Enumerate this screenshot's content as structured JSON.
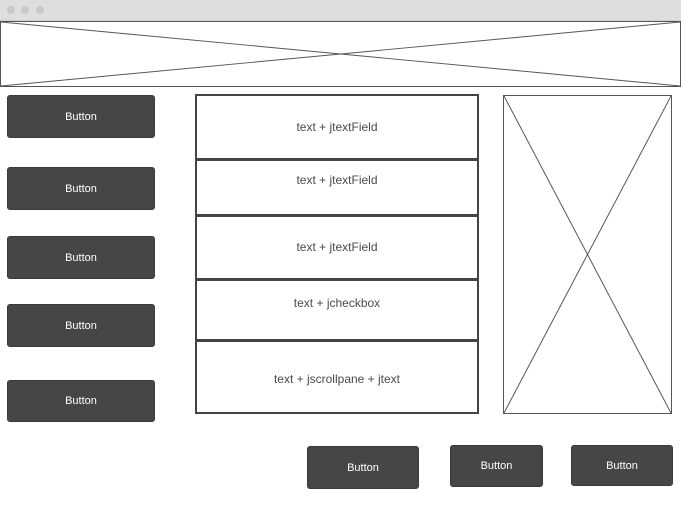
{
  "window": {
    "controls": [
      "close-dot",
      "minimize-dot",
      "maximize-dot"
    ]
  },
  "left_buttons": [
    {
      "label": "Button"
    },
    {
      "label": "Button"
    },
    {
      "label": "Button"
    },
    {
      "label": "Button"
    },
    {
      "label": "Button"
    }
  ],
  "form_rows": [
    {
      "label": "text + jtextField"
    },
    {
      "label": "text + jtextField"
    },
    {
      "label": "text + jtextField"
    },
    {
      "label": "text + jcheckbox"
    },
    {
      "label": "text + jscrollpane + jtext"
    }
  ],
  "bottom_buttons": [
    {
      "label": "Button"
    },
    {
      "label": "Button"
    },
    {
      "label": "Button"
    }
  ],
  "colors": {
    "button_bg": "#464646",
    "button_text": "#ffffff",
    "titlebar": "#dedede",
    "border": "#444444"
  }
}
